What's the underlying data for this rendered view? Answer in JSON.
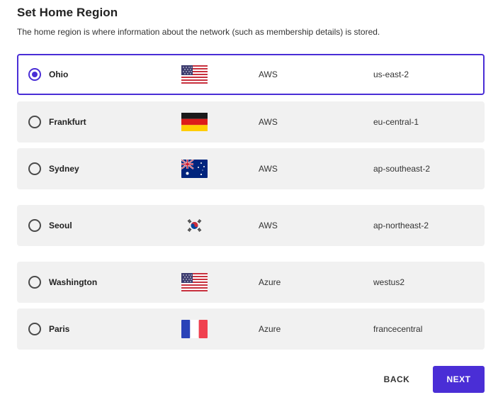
{
  "header": {
    "title": "Set Home Region",
    "subtitle": "The home region is where information about the network (such as membership details) is stored."
  },
  "regions": [
    {
      "city": "Ohio",
      "flag": "us-flag-icon",
      "provider": "AWS",
      "code": "us-east-2",
      "selected": true
    },
    {
      "city": "Frankfurt",
      "flag": "germany-flag-icon",
      "provider": "AWS",
      "code": "eu-central-1",
      "selected": false
    },
    {
      "city": "Sydney",
      "flag": "australia-flag-icon",
      "provider": "AWS",
      "code": "ap-southeast-2",
      "selected": false
    },
    {
      "city": "Seoul",
      "flag": "south-korea-flag-icon",
      "provider": "AWS",
      "code": "ap-northeast-2",
      "selected": false
    },
    {
      "city": "Washington",
      "flag": "us-flag-icon",
      "provider": "Azure",
      "code": "westus2",
      "selected": false
    },
    {
      "city": "Paris",
      "flag": "france-flag-icon",
      "provider": "Azure",
      "code": "francecentral",
      "selected": false
    }
  ],
  "actions": {
    "back_label": "BACK",
    "next_label": "NEXT"
  },
  "colors": {
    "accent": "#4a2ed6",
    "row_background": "#f1f1f1"
  }
}
